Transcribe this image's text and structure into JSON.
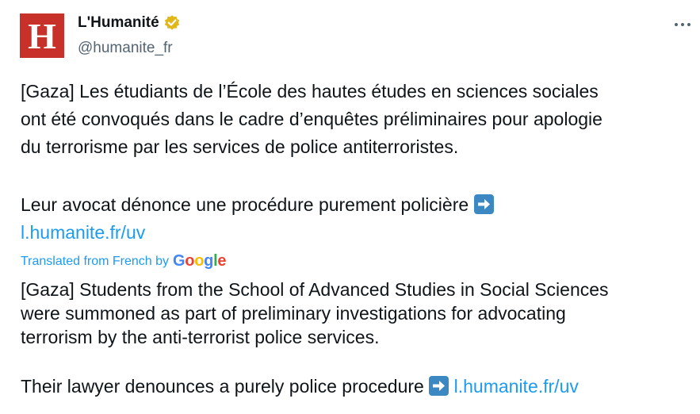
{
  "author": {
    "avatar_letter": "H",
    "name": "L'Humanité",
    "handle": "@humanite_fr"
  },
  "original": {
    "lines": [
      "[Gaza] Les étudiants de l’École des hautes études en sciences sociales",
      "ont été convoqués dans le cadre d’enquêtes préliminaires pour apologie",
      "du terrorisme par les services de police antiterroristes."
    ],
    "second_paragraph": "Leur avocat dénonce une procédure purement policière",
    "link": "l.humanite.fr/uv"
  },
  "translation": {
    "label": "Translated from French by",
    "provider_letters": [
      "G",
      "o",
      "o",
      "g",
      "l",
      "e"
    ],
    "lines": [
      "[Gaza] Students from the School of Advanced Studies in Social Sciences",
      "were summoned as part of preliminary investigations for advocating",
      "terrorism by the anti-terrorist police services."
    ],
    "second_paragraph": "Their lawyer denounces a purely police procedure",
    "link": "l.humanite.fr/uv"
  },
  "colors": {
    "avatar_bg": "#c8312a",
    "link": "#1d9bf0",
    "verified_badge": "#e2b719",
    "google": [
      "#4285f4",
      "#ea4335",
      "#fbbc05",
      "#4285f4",
      "#34a853",
      "#ea4335"
    ]
  },
  "icons": {
    "more": "more-horizontal-icon",
    "verified": "verified-badge-icon",
    "arrow": "right-arrow-emoji"
  }
}
